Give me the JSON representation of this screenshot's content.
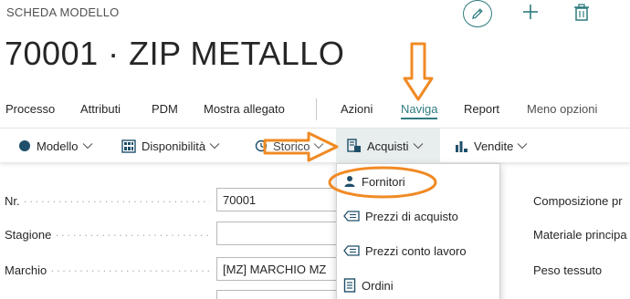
{
  "header": {
    "entity_label": "SCHEDA MODELLO",
    "title": "70001 · ZIP METALLO"
  },
  "top_actions": [
    "edit-icon",
    "plus-icon",
    "trash-icon"
  ],
  "menu": {
    "items": [
      "Processo",
      "Attributi",
      "PDM",
      "Mostra allegato",
      "Azioni",
      "Naviga",
      "Report",
      "Meno opzioni"
    ],
    "active": "Naviga"
  },
  "toolbar": {
    "items": [
      {
        "label": "Modello",
        "icon": "circle-icon"
      },
      {
        "label": "Disponibilità",
        "icon": "grid-icon"
      },
      {
        "label": "Storico",
        "icon": "history-icon"
      },
      {
        "label": "Acquisti",
        "icon": "purchase-icon"
      },
      {
        "label": "Vendite",
        "icon": "sales-icon"
      }
    ],
    "open": "Acquisti"
  },
  "dropdown": {
    "items": [
      {
        "label": "Fornitori",
        "icon": "person-icon"
      },
      {
        "label": "Prezzi di acquisto",
        "icon": "price-tag-icon"
      },
      {
        "label": "Prezzi conto lavoro",
        "icon": "price-tag-icon"
      },
      {
        "label": "Ordini",
        "icon": "document-icon"
      }
    ]
  },
  "form": {
    "fields": [
      {
        "label": "Nr.",
        "value": "70001"
      },
      {
        "label": "Stagione",
        "value": ""
      },
      {
        "label": "Marchio",
        "value": "[MZ] MARCHIO MZ"
      }
    ],
    "right_labels": [
      "Composizione pr",
      "Materiale principa",
      "Peso tessuto"
    ]
  },
  "colors": {
    "accent": "#2f7b7e",
    "annotation": "#f08a24"
  }
}
